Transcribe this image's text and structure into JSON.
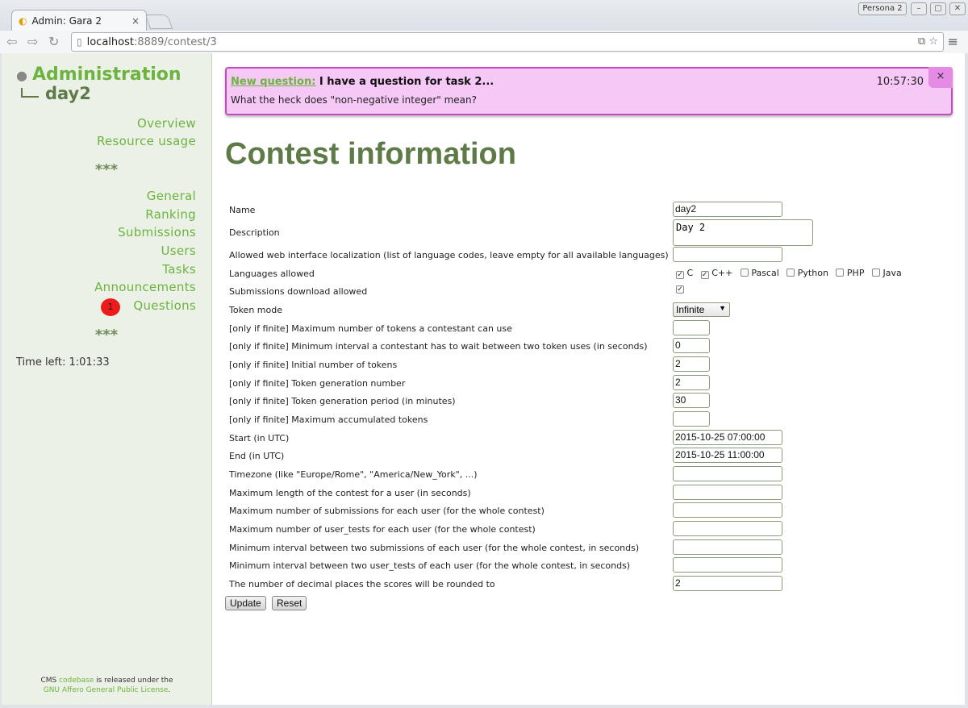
{
  "browser": {
    "tab_title": "Admin: Gara 2",
    "tab_close": "×",
    "persona_label": "Persona 2",
    "url_host": "localhost",
    "url_path": ":8889/contest/3"
  },
  "sidebar": {
    "title": "Administration",
    "contest": "day2",
    "menu_top": [
      "Overview",
      "Resource usage"
    ],
    "separator": "***",
    "menu_main": [
      "General",
      "Ranking",
      "Submissions",
      "Users",
      "Tasks",
      "Announcements",
      "Questions"
    ],
    "questions_badge": "1",
    "time_left": "Time left: 1:01:33",
    "footer": {
      "prefix": "CMS ",
      "link1": "codebase",
      "middle": " is released under the",
      "link2": "GNU Affero General Public License",
      "suffix": "."
    }
  },
  "notification": {
    "link": "New question:",
    "subject": " I have a question for task 2...",
    "time": "10:57:30",
    "body": "What the heck does \"non-negative integer\" mean?",
    "close": "×"
  },
  "main": {
    "title": "Contest information",
    "fields": [
      {
        "label": "Name",
        "value": "day2"
      },
      {
        "label": "Description",
        "value": "Day 2"
      },
      {
        "label": "Allowed web interface localization (list of language codes, leave empty for all available languages)",
        "value": ""
      },
      {
        "label": "Languages allowed"
      },
      {
        "label": "Submissions download allowed"
      },
      {
        "label": "Token mode",
        "value": "Infinite"
      },
      {
        "label": "[only if finite] Maximum number of tokens a contestant can use",
        "value": ""
      },
      {
        "label": "[only if finite] Minimum interval a contestant has to wait between two token uses (in seconds)",
        "value": "0"
      },
      {
        "label": "[only if finite] Initial number of tokens",
        "value": "2"
      },
      {
        "label": "[only if finite] Token generation number",
        "value": "2"
      },
      {
        "label": "[only if finite] Token generation period (in minutes)",
        "value": "30"
      },
      {
        "label": "[only if finite] Maximum accumulated tokens",
        "value": ""
      },
      {
        "label": "Start (in UTC)",
        "value": "2015-10-25 07:00:00"
      },
      {
        "label": "End (in UTC)",
        "value": "2015-10-25 11:00:00"
      },
      {
        "label": "Timezone (like \"Europe/Rome\", \"America/New_York\", ...)",
        "value": ""
      },
      {
        "label": "Maximum length of the contest for a user (in seconds)",
        "value": ""
      },
      {
        "label": "Maximum number of submissions for each user (for the whole contest)",
        "value": ""
      },
      {
        "label": "Maximum number of user_tests for each user (for the whole contest)",
        "value": ""
      },
      {
        "label": "Minimum interval between two submissions of each user (for the whole contest, in seconds)",
        "value": ""
      },
      {
        "label": "Minimum interval between two user_tests of each user (for the whole contest, in seconds)",
        "value": ""
      },
      {
        "label": "The number of decimal places the scores will be rounded to",
        "value": "2"
      }
    ],
    "languages": [
      {
        "name": "C",
        "checked": true
      },
      {
        "name": "C++",
        "checked": true
      },
      {
        "name": "Pascal",
        "checked": false
      },
      {
        "name": "Python",
        "checked": false
      },
      {
        "name": "PHP",
        "checked": false
      },
      {
        "name": "Java",
        "checked": false
      }
    ],
    "submissions_download_checked": true,
    "buttons": {
      "update": "Update",
      "reset": "Reset"
    }
  }
}
